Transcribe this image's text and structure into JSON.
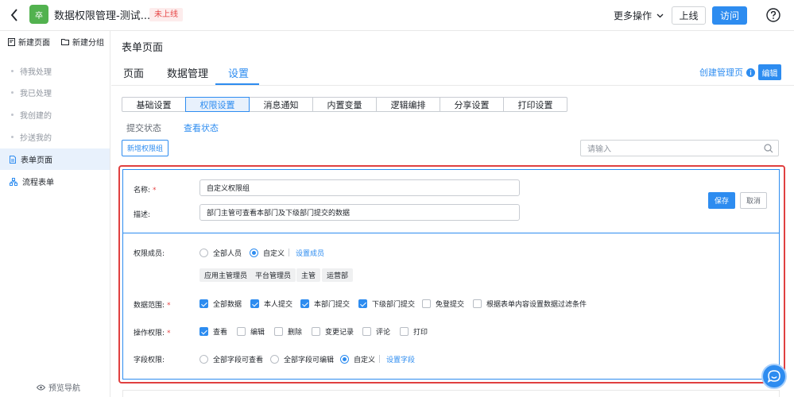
{
  "header": {
    "app_logo_text": "卒",
    "title": "数据权限管理-测试...",
    "status": "未上线",
    "more_ops": "更多操作",
    "online_btn": "上线",
    "visit_btn": "访问"
  },
  "sidebar": {
    "new_page": "新建页面",
    "new_group": "新建分组",
    "items": [
      {
        "label": "待我处理"
      },
      {
        "label": "我已处理"
      },
      {
        "label": "我创建的"
      },
      {
        "label": "抄送我的"
      },
      {
        "label": "表单页面"
      },
      {
        "label": "流程表单"
      }
    ],
    "preview_nav": "预览导航"
  },
  "main": {
    "page_title": "表单页面",
    "tabs": [
      {
        "label": "页面"
      },
      {
        "label": "数据管理"
      },
      {
        "label": "设置"
      }
    ],
    "create_page_link": "创建管理页",
    "edit_btn": "编辑",
    "subtabs": [
      {
        "label": "基础设置"
      },
      {
        "label": "权限设置"
      },
      {
        "label": "消息通知"
      },
      {
        "label": "内置变量"
      },
      {
        "label": "逻辑编排"
      },
      {
        "label": "分享设置"
      },
      {
        "label": "打印设置"
      }
    ],
    "submit_status": "提交状态",
    "view_status": "查看状态",
    "add_group_btn": "新增权限组",
    "search_placeholder": "请输入"
  },
  "group": {
    "name_label": "名称:",
    "name_value": "自定义权限组",
    "desc_label": "描述:",
    "desc_value": "部门主管可查看本部门及下级部门提交的数据",
    "save_btn": "保存",
    "cancel_btn": "取消",
    "members_label": "权限成员:",
    "members_all": "全部人员",
    "members_custom": "自定义",
    "set_members": "设置成员",
    "member_tags": [
      "应用主管理员",
      "平台管理员",
      "主管",
      "运营部"
    ],
    "scope_label": "数据范围:",
    "scope_options": [
      {
        "label": "全部数据",
        "checked": true
      },
      {
        "label": "本人提交",
        "checked": true
      },
      {
        "label": "本部门提交",
        "checked": true
      },
      {
        "label": "下级部门提交",
        "checked": true
      },
      {
        "label": "免登提交",
        "checked": false
      },
      {
        "label": "根据表单内容设置数据过滤条件",
        "checked": false
      }
    ],
    "ops_label": "操作权限:",
    "ops_options": [
      {
        "label": "查看",
        "checked": true
      },
      {
        "label": "编辑",
        "checked": false
      },
      {
        "label": "删除",
        "checked": false
      },
      {
        "label": "变更记录",
        "checked": false
      },
      {
        "label": "评论",
        "checked": false
      },
      {
        "label": "打印",
        "checked": false
      }
    ],
    "fields_label": "字段权限:",
    "fields_options": [
      {
        "label": "全部字段可查看",
        "selected": false
      },
      {
        "label": "全部字段可编辑",
        "selected": false
      },
      {
        "label": "自定义",
        "selected": true
      }
    ],
    "set_fields": "设置字段",
    "required_mark": "*"
  },
  "colors": {
    "accent": "#2d8cf0",
    "danger": "#e64545",
    "highlight": "#e04040",
    "logo": "#52b24f"
  }
}
